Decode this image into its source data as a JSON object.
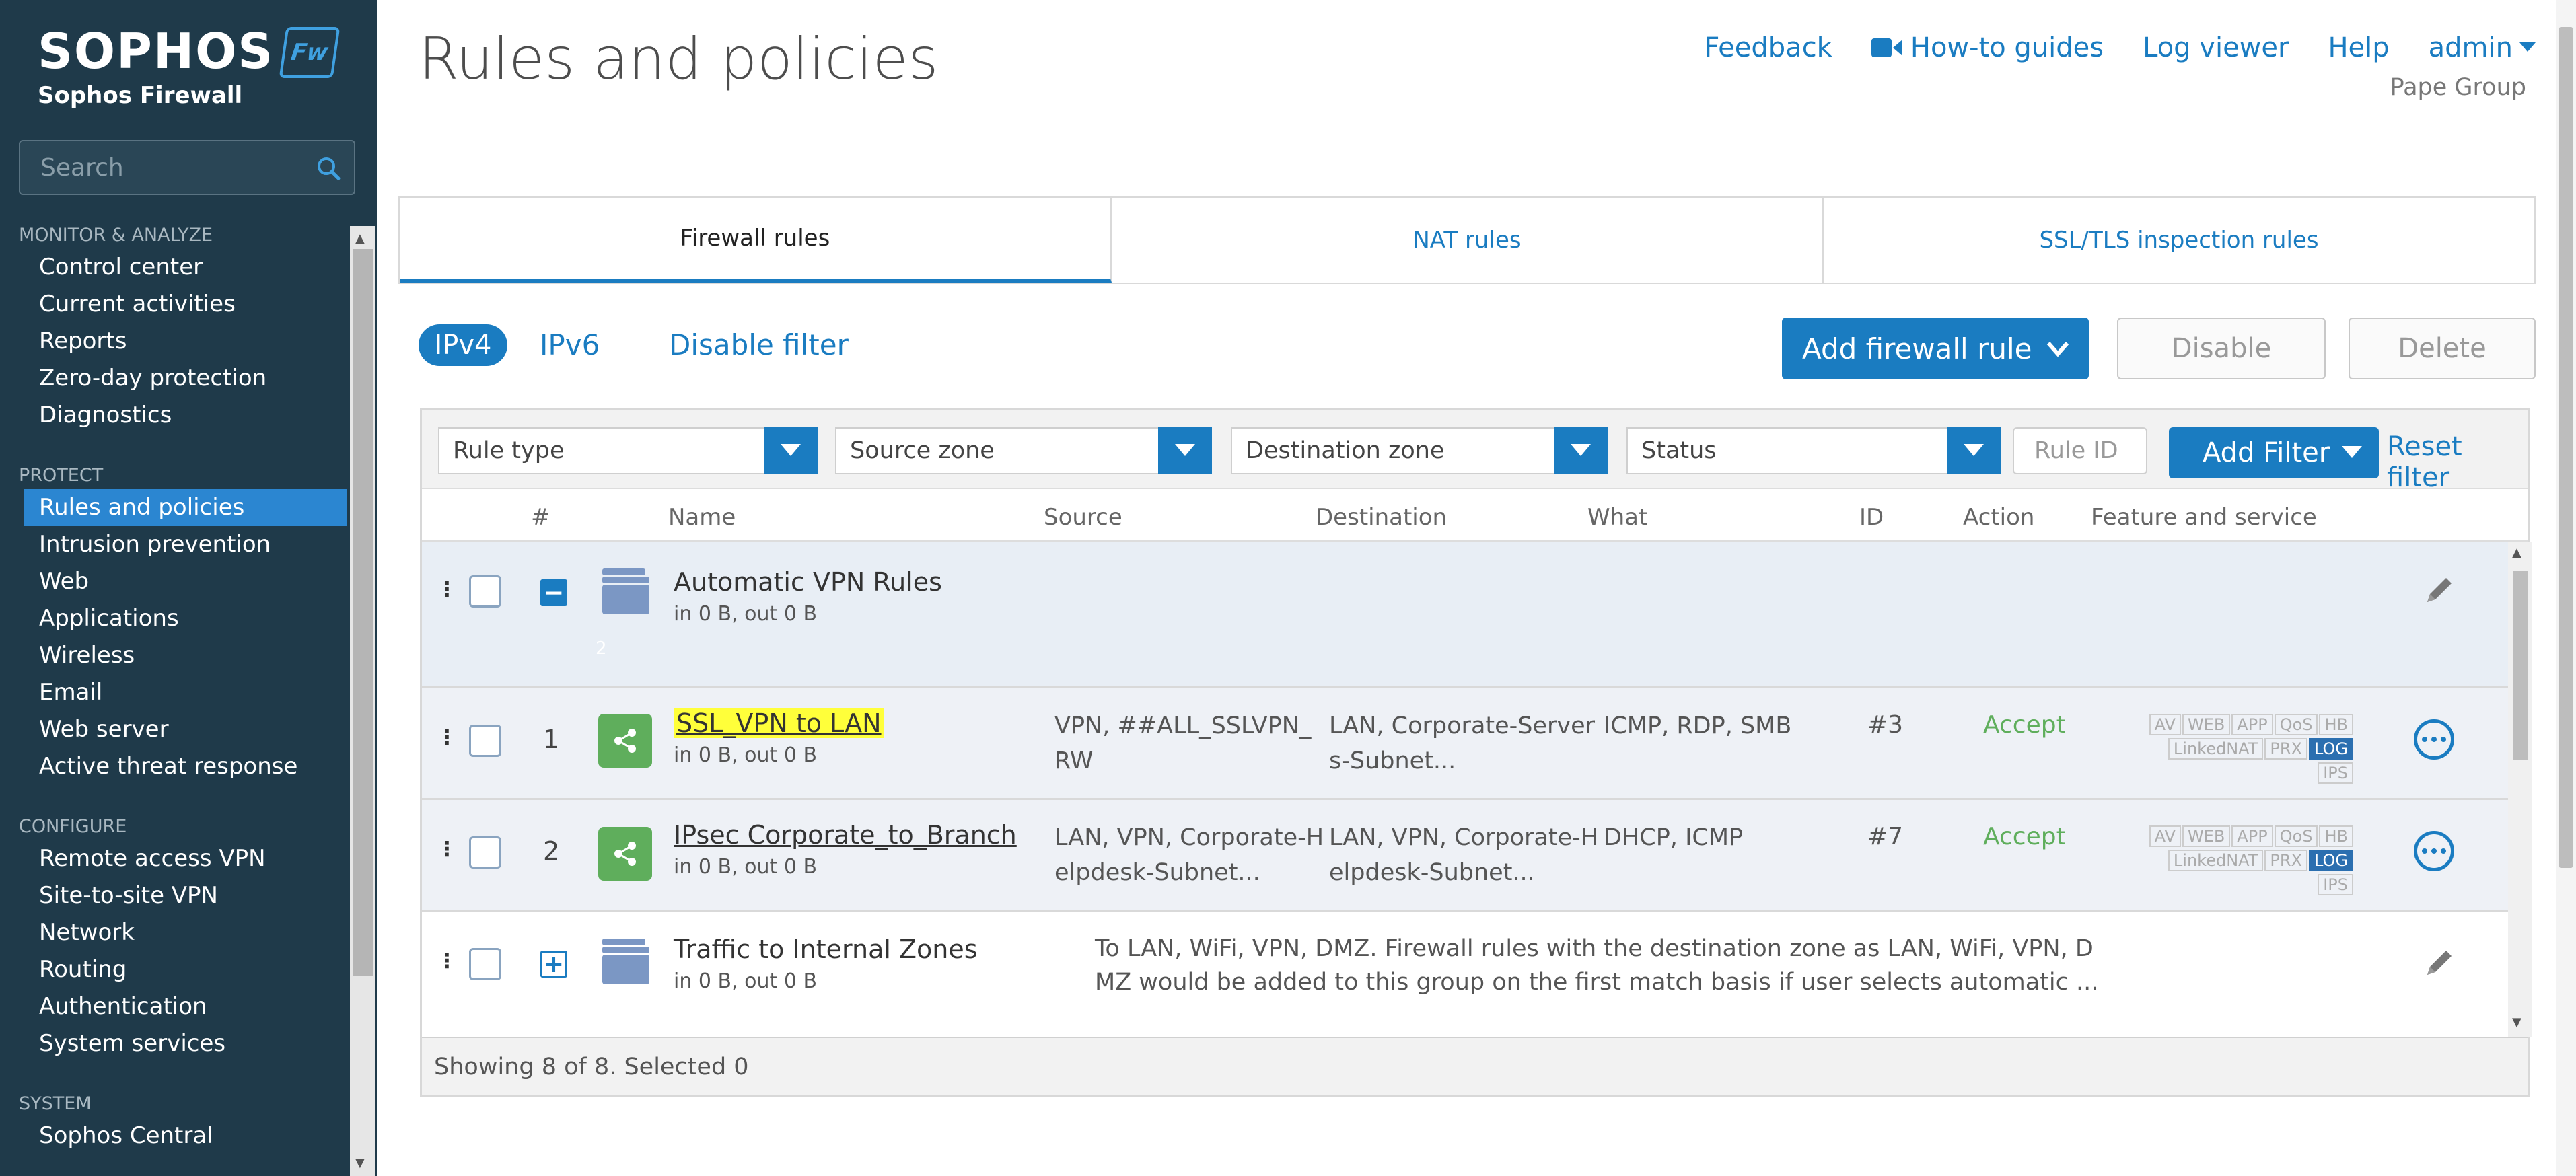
{
  "brand": {
    "name": "SOPHOS",
    "product": "Sophos Firewall",
    "badge": "Fw",
    "accent": "#1a7cc1",
    "sidebar_bg": "#1f3a4a"
  },
  "search": {
    "placeholder": "Search"
  },
  "sidebar": {
    "sections": [
      {
        "title": "MONITOR & ANALYZE",
        "items": [
          "Control center",
          "Current activities",
          "Reports",
          "Zero-day protection",
          "Diagnostics"
        ]
      },
      {
        "title": "PROTECT",
        "items": [
          "Rules and policies",
          "Intrusion prevention",
          "Web",
          "Applications",
          "Wireless",
          "Email",
          "Web server",
          "Active threat response"
        ]
      },
      {
        "title": "CONFIGURE",
        "items": [
          "Remote access VPN",
          "Site-to-site VPN",
          "Network",
          "Routing",
          "Authentication",
          "System services"
        ]
      },
      {
        "title": "SYSTEM",
        "items": [
          "Sophos Central"
        ]
      }
    ],
    "active_item": "Rules and policies"
  },
  "header": {
    "title": "Rules and policies",
    "links": {
      "feedback": "Feedback",
      "howto": "How-to guides",
      "log_viewer": "Log viewer",
      "help": "Help",
      "user": "admin"
    },
    "org": "Pape Group"
  },
  "tabs": [
    {
      "label": "Firewall rules",
      "active": true
    },
    {
      "label": "NAT rules",
      "active": false
    },
    {
      "label": "SSL/TLS inspection rules",
      "active": false
    }
  ],
  "toolbar": {
    "ipv4": "IPv4",
    "ipv6": "IPv6",
    "disable_filter": "Disable filter",
    "add_rule": "Add firewall rule",
    "disable": "Disable",
    "delete": "Delete"
  },
  "filters": {
    "rule_type": "Rule type",
    "source_zone": "Source zone",
    "destination_zone": "Destination zone",
    "status": "Status",
    "rule_id_placeholder": "Rule ID",
    "add_filter": "Add Filter",
    "reset_filter": "Reset filter"
  },
  "columns": [
    "#",
    "Name",
    "Source",
    "Destination",
    "What",
    "ID",
    "Action",
    "Feature and service"
  ],
  "rows": {
    "group1": {
      "name": "Automatic VPN Rules",
      "stats": "in 0 B, out 0 B",
      "count": "2"
    },
    "rule1": {
      "num": "1",
      "name": "SSL_VPN to LAN",
      "stats": "in 0 B, out 0 B",
      "source": "VPN, ##ALL_SSLVPN_",
      "source2": "RW",
      "destination": "LAN, Corporate-Server",
      "destination2": "s-Subnet...",
      "what": "ICMP, RDP, SMB",
      "id": "#3",
      "action": "Accept"
    },
    "rule2": {
      "num": "2",
      "name": "IPsec Corporate_to_Branch",
      "stats": "in 0 B, out 0 B",
      "source": "LAN, VPN, Corporate-H",
      "source2": "elpdesk-Subnet...",
      "destination": "LAN, VPN, Corporate-H",
      "destination2": "elpdesk-Subnet...",
      "what": "DHCP, ICMP",
      "id": "#7",
      "action": "Accept"
    },
    "group2": {
      "name": "Traffic to Internal Zones",
      "stats": "in 0 B, out 0 B",
      "desc1": "To LAN, WiFi, VPN, DMZ. Firewall rules with the destination zone as LAN, WiFi, VPN, D",
      "desc2": "MZ would be added to this group on the first match basis if user selects automatic ..."
    }
  },
  "feature_tags": {
    "row1": [
      "AV",
      "WEB",
      "APP",
      "QoS",
      "HB"
    ],
    "row2": [
      "LinkedNAT",
      "PRX",
      "LOG",
      "IPS"
    ],
    "active": "LOG"
  },
  "footer": {
    "status": "Showing 8 of 8. Selected 0"
  }
}
